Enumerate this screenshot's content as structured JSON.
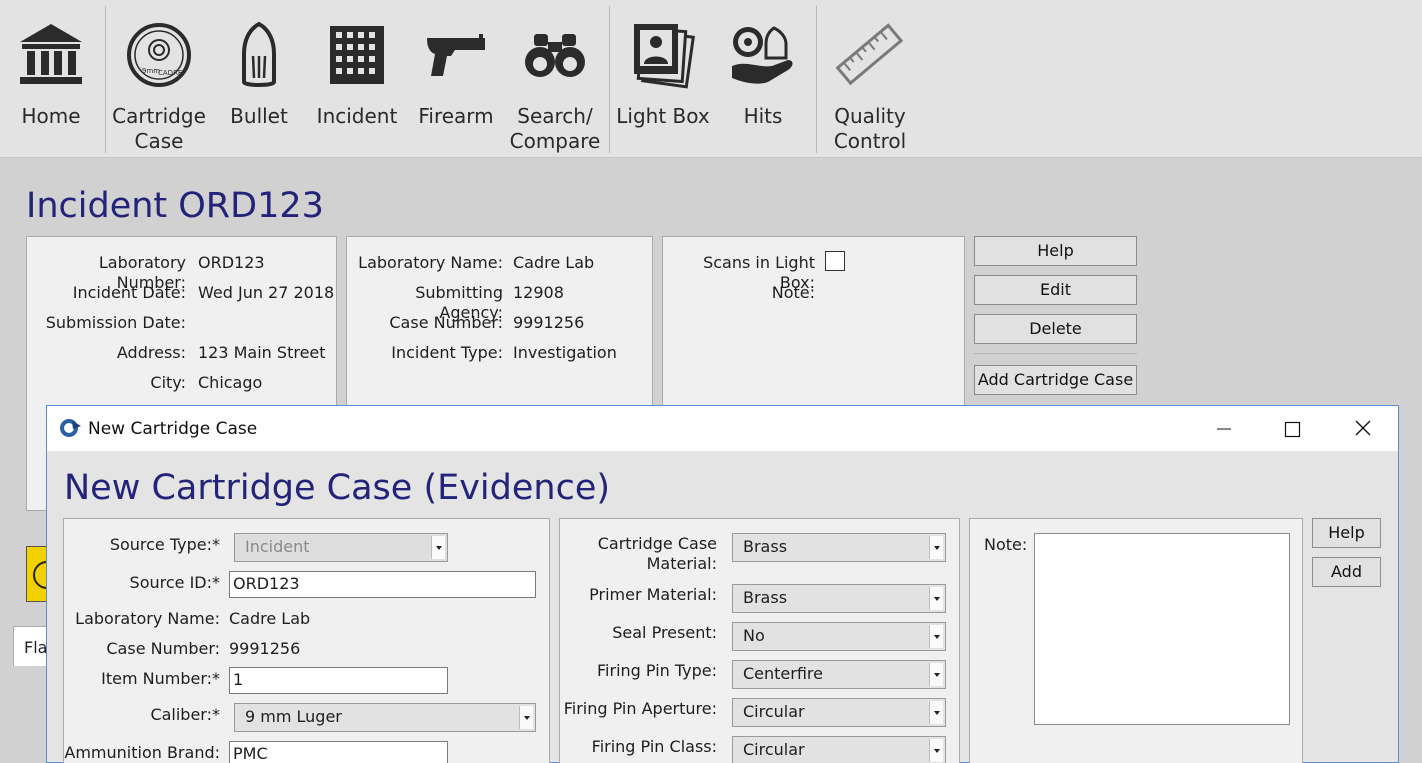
{
  "ribbon": {
    "home": "Home",
    "cartridge_case_1": "Cartridge",
    "cartridge_case_2": "Case",
    "bullet": "Bullet",
    "incident": "Incident",
    "firearm": "Firearm",
    "search_1": "Search/",
    "search_2": "Compare",
    "light_box": "Light Box",
    "hits": "Hits",
    "qc_1": "Quality",
    "qc_2": "Control",
    "cadre_text": "CADRE",
    "caliber_text": "9mm"
  },
  "incident": {
    "title": "Incident ORD123",
    "lab_number_label": "Laboratory Number:",
    "lab_number": "ORD123",
    "incident_date_label": "Incident Date:",
    "incident_date": "Wed Jun 27 2018",
    "submission_date_label": "Submission Date:",
    "address_label": "Address:",
    "address": "123 Main Street",
    "city_label": "City:",
    "city": "Chicago",
    "lab_name_label": "Laboratory Name:",
    "lab_name": "Cadre Lab",
    "agency_label": "Submitting Agency:",
    "agency": "12908",
    "case_number_label": "Case Number:",
    "case_number": "9991256",
    "incident_type_label": "Incident Type:",
    "incident_type": "Investigation",
    "scans_label": "Scans in Light Box:",
    "note_label": "Note:",
    "help": "Help",
    "edit": "Edit",
    "delete": "Delete",
    "add_cc": "Add Cartridge Case",
    "tab_partial": "Fla"
  },
  "dialog": {
    "window_title": "New Cartridge Case",
    "title": "New Cartridge Case (Evidence)",
    "source_type_label": "Source Type:*",
    "source_type": "Incident",
    "source_id_label": "Source ID:*",
    "source_id": "ORD123",
    "lab_name_label": "Laboratory Name:",
    "lab_name": "Cadre Lab",
    "case_number_label": "Case Number:",
    "case_number": "9991256",
    "item_number_label": "Item Number:*",
    "item_number": "1",
    "caliber_label": "Caliber:*",
    "caliber": "9 mm Luger",
    "ammo_brand_label": "Ammunition Brand:",
    "ammo_brand": "PMC",
    "cc_material_label_1": "Cartridge Case",
    "cc_material_label_2": "Material:",
    "cc_material": "Brass",
    "primer_label": "Primer Material:",
    "primer": "Brass",
    "seal_label": "Seal Present:",
    "seal": "No",
    "fp_type_label": "Firing Pin Type:",
    "fp_type": "Centerfire",
    "fp_aperture_label": "Firing Pin Aperture:",
    "fp_aperture": "Circular",
    "fp_class_label": "Firing Pin Class:",
    "fp_class": "Circular",
    "note_label": "Note:",
    "help": "Help",
    "add": "Add"
  }
}
